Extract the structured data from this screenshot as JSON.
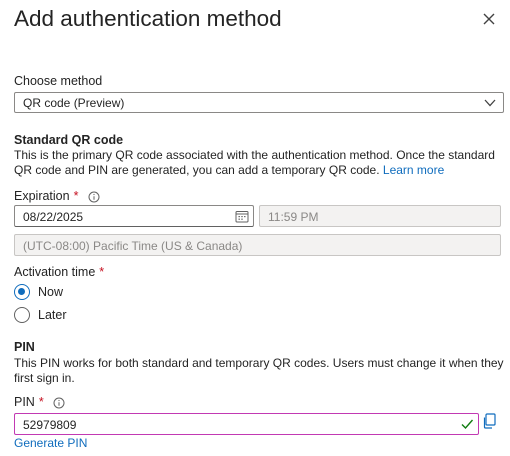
{
  "header": {
    "title": "Add authentication method"
  },
  "method": {
    "label": "Choose method",
    "selected": "QR code (Preview)"
  },
  "standard_qr": {
    "title": "Standard QR code",
    "description": "This is the primary QR code associated with the authentication method. Once the standard QR code and PIN are generated, you can add a temporary QR code.",
    "learn_more": "Learn more"
  },
  "expiration": {
    "label": "Expiration",
    "required_mark": "*",
    "date": "08/22/2025",
    "time": "11:59 PM",
    "timezone": "(UTC-08:00) Pacific Time (US & Canada)"
  },
  "activation": {
    "label": "Activation time",
    "required_mark": "*",
    "options": [
      {
        "label": "Now",
        "checked": true
      },
      {
        "label": "Later",
        "checked": false
      }
    ]
  },
  "pin_section": {
    "title": "PIN",
    "description": "This PIN works for both standard and temporary QR codes. Users must change it when they first sign in.",
    "field_label": "PIN",
    "required_mark": "*",
    "value": "52979809",
    "generate_label": "Generate PIN"
  },
  "colors": {
    "accent": "#0f6cbd",
    "required": "#c50f1f",
    "pin_border": "#c239b3",
    "valid_check": "#107c10"
  }
}
